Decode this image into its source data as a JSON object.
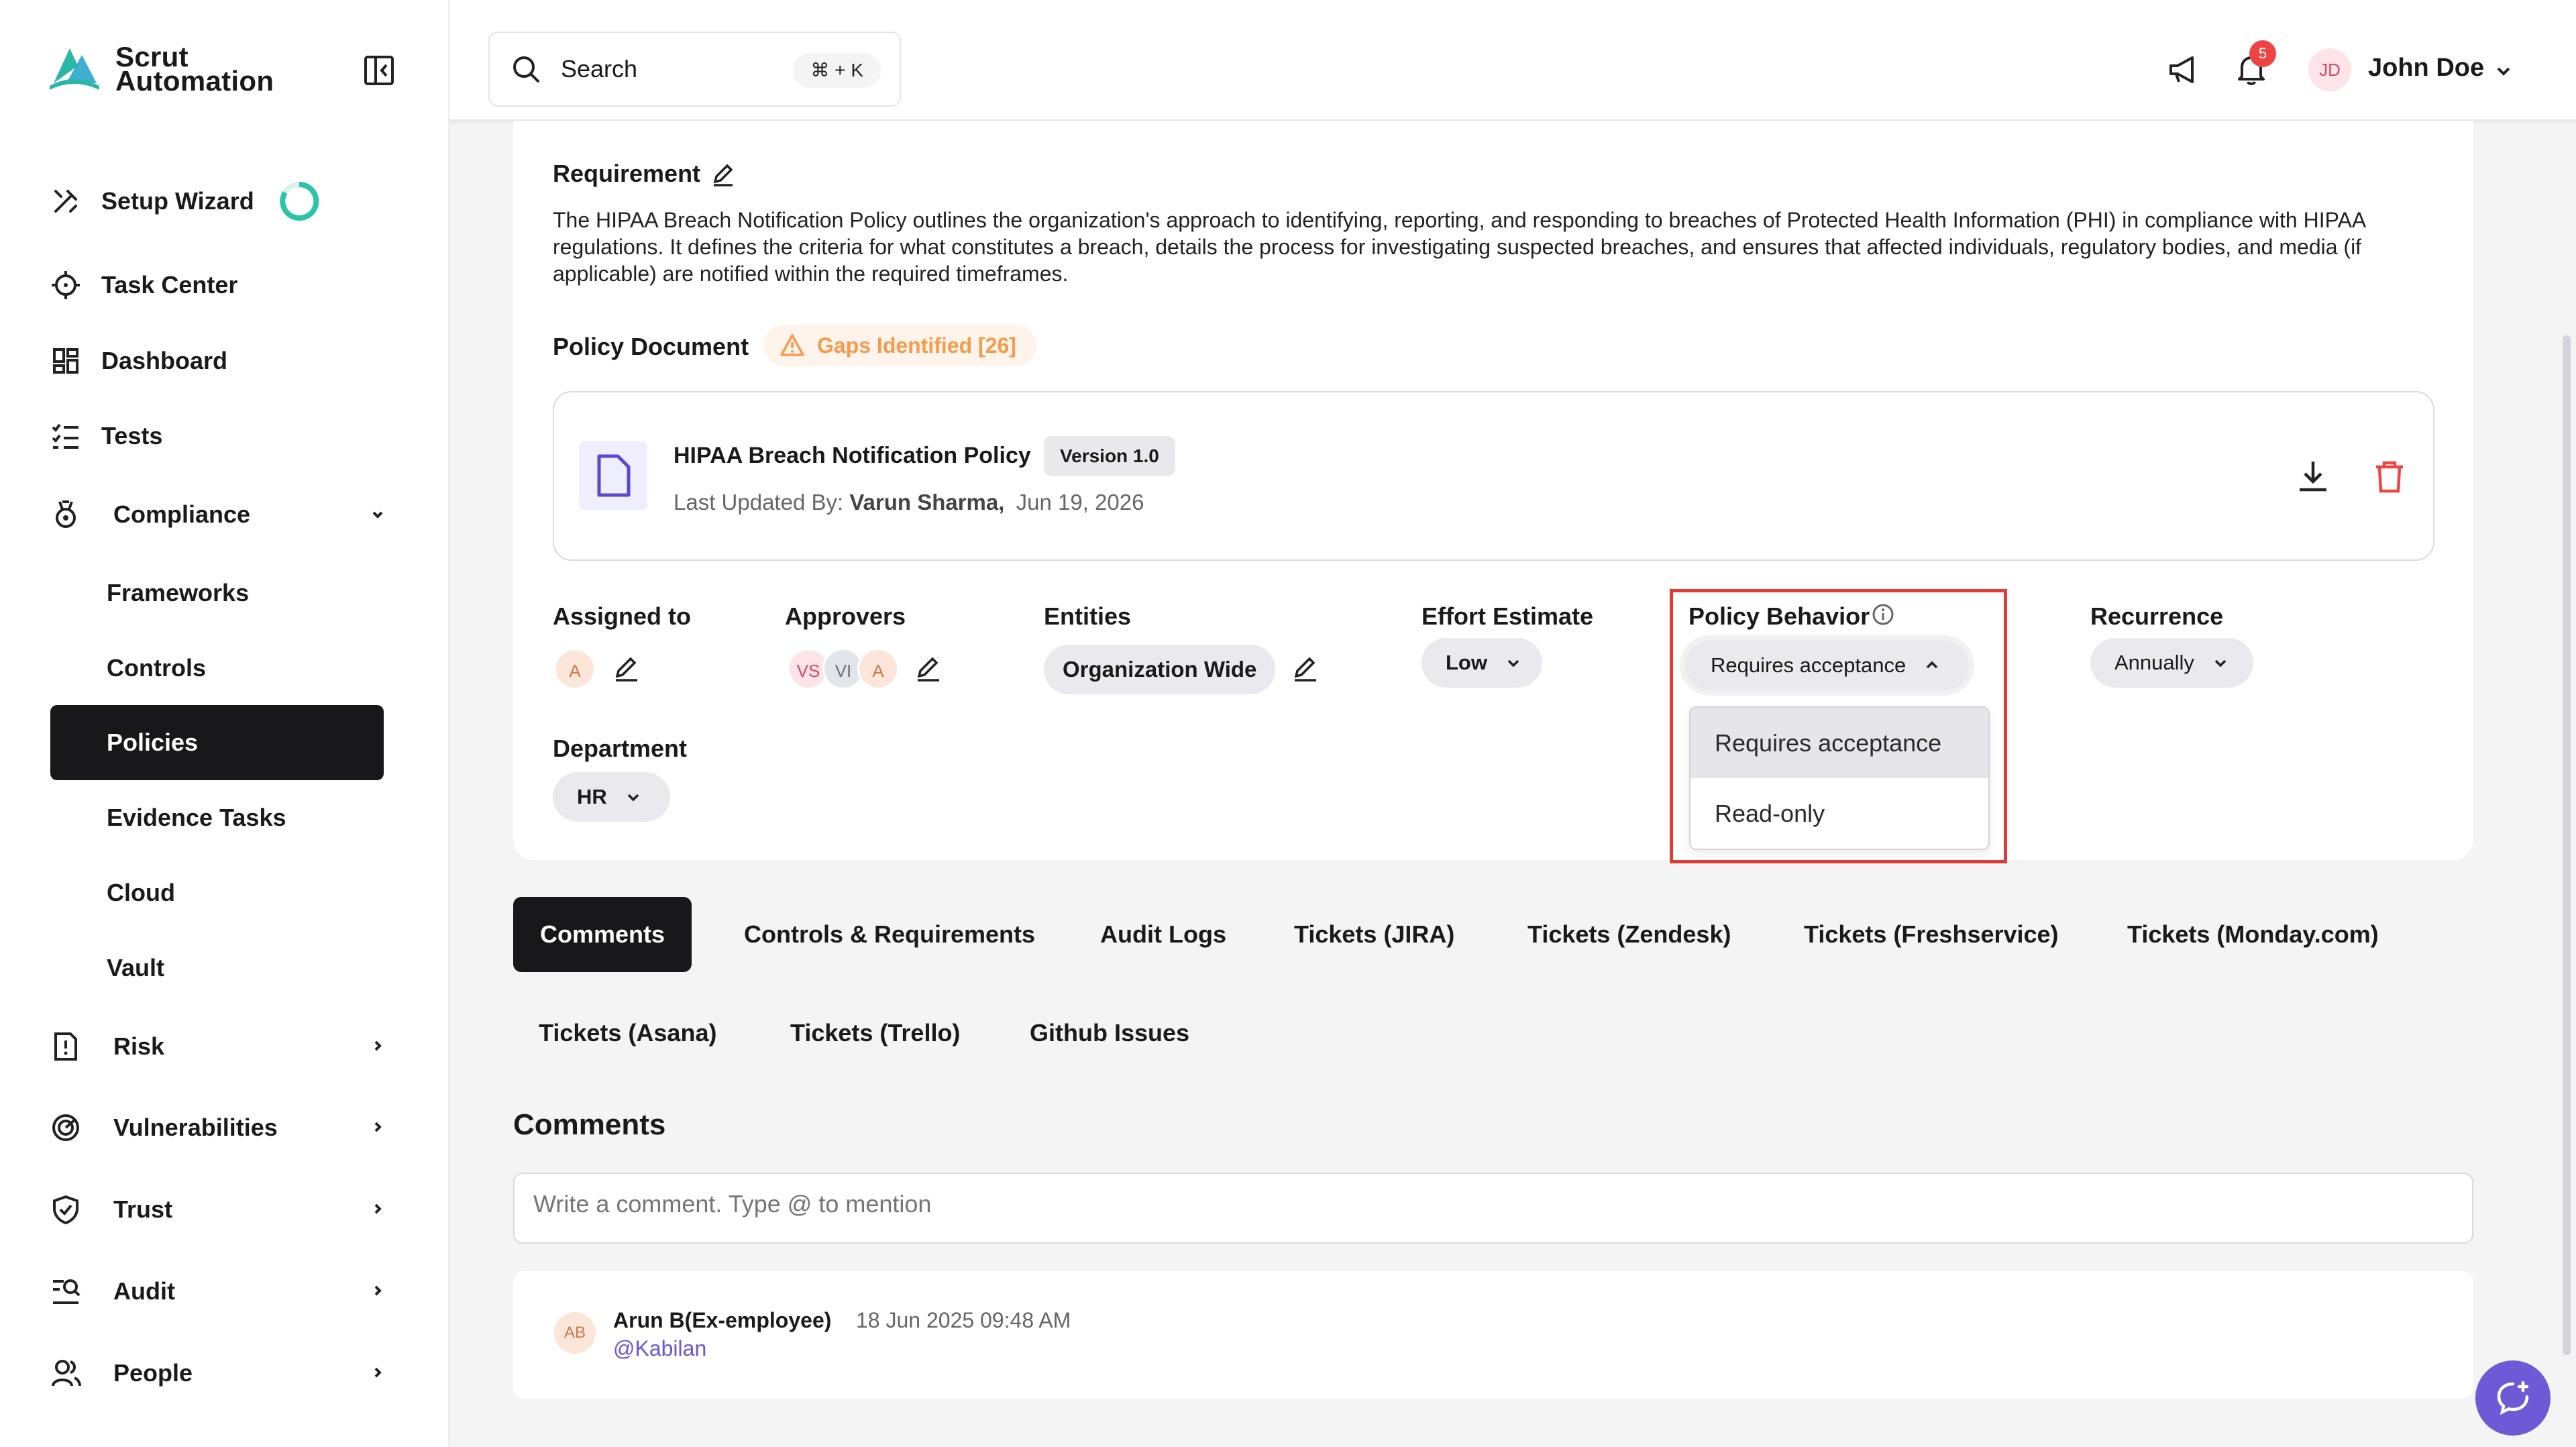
{
  "brand": {
    "line1": "Scrut",
    "line2": "Automation"
  },
  "sidebar": {
    "items": [
      {
        "label": "Setup Wizard"
      },
      {
        "label": "Task Center"
      },
      {
        "label": "Dashboard"
      },
      {
        "label": "Tests"
      },
      {
        "label": "Compliance"
      },
      {
        "label": "Risk"
      },
      {
        "label": "Vulnerabilities"
      },
      {
        "label": "Trust"
      },
      {
        "label": "Audit"
      },
      {
        "label": "People"
      }
    ],
    "compliance_sub": [
      {
        "label": "Frameworks"
      },
      {
        "label": "Controls"
      },
      {
        "label": "Policies",
        "active": true
      },
      {
        "label": "Evidence Tasks"
      },
      {
        "label": "Cloud"
      },
      {
        "label": "Vault"
      }
    ]
  },
  "topbar": {
    "search_label": "Search",
    "search_shortcut": "⌘ + K",
    "notifications_count": "5",
    "user_initials": "JD",
    "user_name": "John Doe"
  },
  "requirement": {
    "title": "Requirement",
    "text": "The HIPAA Breach Notification Policy outlines the organization's approach to identifying, reporting, and responding to breaches of Protected Health Information (PHI) in compliance with HIPAA regulations. It defines the criteria for what constitutes a breach, details the process for investigating suspected breaches, and ensures that affected individuals, regulatory bodies, and media (if applicable) are notified within the required timeframes."
  },
  "policy_document": {
    "title": "Policy Document",
    "gaps_label": "Gaps Identified [26]",
    "name": "HIPAA Breach Notification Policy",
    "version": "Version 1.0",
    "updated_prefix": "Last Updated By:",
    "updated_by": "Varun Sharma,",
    "updated_date": "Jun 19, 2026"
  },
  "fields": {
    "assigned_to": {
      "label": "Assigned to",
      "avatars": [
        "A"
      ]
    },
    "approvers": {
      "label": "Approvers",
      "avatars": [
        "VS",
        "VI",
        "A"
      ]
    },
    "entities": {
      "label": "Entities",
      "value": "Organization Wide"
    },
    "effort": {
      "label": "Effort Estimate",
      "value": "Low"
    },
    "policy_behavior": {
      "label": "Policy Behavior",
      "value": "Requires acceptance",
      "options": [
        "Requires acceptance",
        "Read-only"
      ]
    },
    "recurrence": {
      "label": "Recurrence",
      "value": "Annually"
    },
    "department": {
      "label": "Department",
      "value": "HR"
    }
  },
  "tabs": [
    {
      "label": "Comments",
      "active": true
    },
    {
      "label": "Controls & Requirements"
    },
    {
      "label": "Audit Logs"
    },
    {
      "label": "Tickets (JIRA)"
    },
    {
      "label": "Tickets (Zendesk)"
    },
    {
      "label": "Tickets (Freshservice)"
    },
    {
      "label": "Tickets (Monday.com)"
    },
    {
      "label": "Tickets (Asana)"
    },
    {
      "label": "Tickets (Trello)"
    },
    {
      "label": "Github Issues"
    }
  ],
  "comments": {
    "title": "Comments",
    "placeholder": "Write a comment. Type @ to mention",
    "items": [
      {
        "initials": "AB",
        "author": "Arun B(Ex-employee)",
        "time": "18 Jun 2025 09:48 AM",
        "body": "@Kabilan"
      }
    ]
  },
  "colors": {
    "accent_dark": "#18181b",
    "highlight_red": "#e53935",
    "gaps_orange": "#f59b4c",
    "brand_teal": "#2bb7a5",
    "fab_purple": "#6e5ad6"
  }
}
